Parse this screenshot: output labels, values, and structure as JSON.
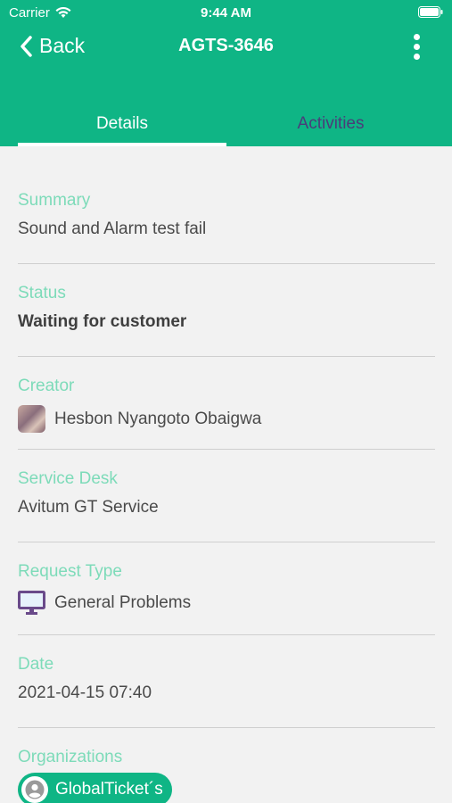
{
  "status_bar": {
    "carrier": "Carrier",
    "time": "9:44 AM"
  },
  "nav": {
    "back_label": "Back",
    "title": "AGTS-3646"
  },
  "tabs": [
    {
      "label": "Details"
    },
    {
      "label": "Activities"
    }
  ],
  "fields": {
    "summary": {
      "label": "Summary",
      "value": "Sound and Alarm test fail"
    },
    "status": {
      "label": "Status",
      "value": "Waiting for customer"
    },
    "creator": {
      "label": "Creator",
      "value": "Hesbon Nyangoto Obaigwa"
    },
    "service_desk": {
      "label": "Service Desk",
      "value": "Avitum GT Service"
    },
    "request_type": {
      "label": "Request Type",
      "value": "General Problems",
      "icon": "monitor-icon"
    },
    "date": {
      "label": "Date",
      "value": "2021-04-15 07:40"
    },
    "organizations": {
      "label": "Organizations",
      "value": "GlobalTicket´s"
    }
  },
  "colors": {
    "accent": "#0fb585",
    "label": "#7ddbb9",
    "tab_inactive": "#4a3d7a"
  }
}
